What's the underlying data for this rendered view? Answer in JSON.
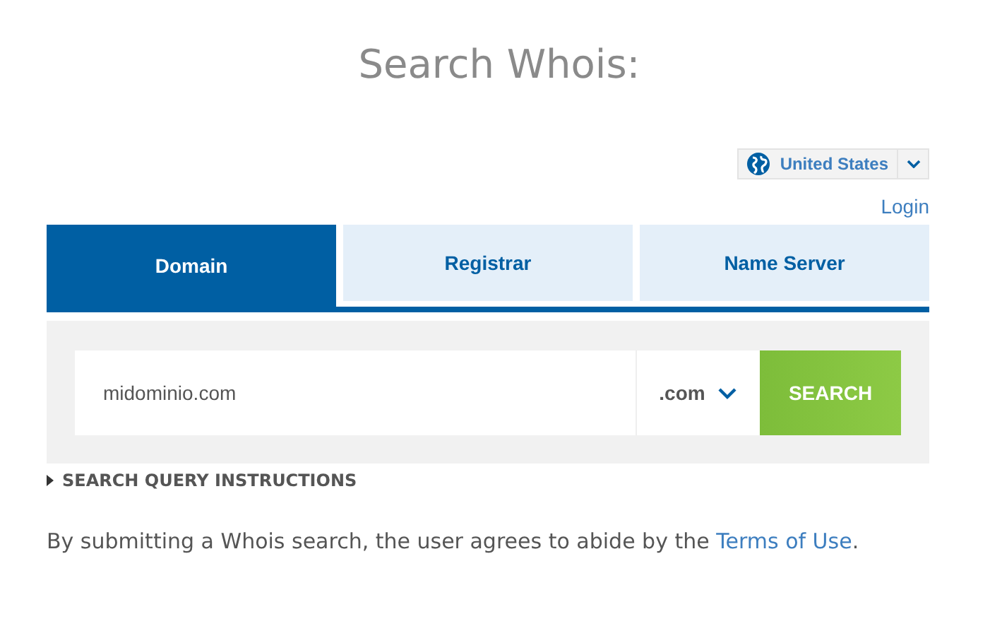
{
  "title": "Search Whois:",
  "region": {
    "label": "United States"
  },
  "login": "Login",
  "tabs": [
    {
      "label": "Domain",
      "selected": true
    },
    {
      "label": "Registrar",
      "selected": false
    },
    {
      "label": "Name Server",
      "selected": false
    }
  ],
  "search": {
    "value": "midominio.com",
    "tld": ".com",
    "button": "SEARCH"
  },
  "instructions": {
    "label": "SEARCH QUERY INSTRUCTIONS",
    "expanded": false
  },
  "notice": {
    "text": "By submitting a Whois search, the user agrees to abide by the ",
    "link": "Terms of Use",
    "end": "."
  }
}
